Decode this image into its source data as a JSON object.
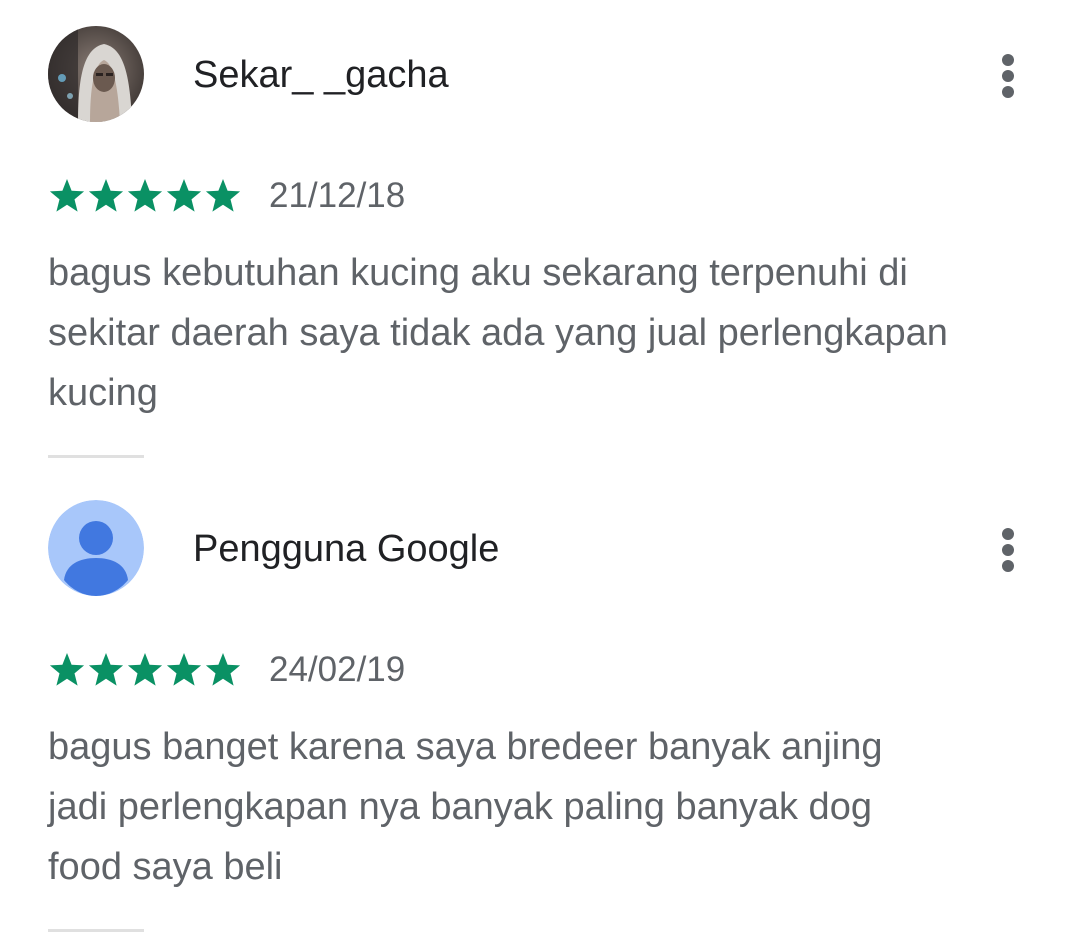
{
  "colors": {
    "star": "#0a9164",
    "author_text": "#202124",
    "secondary_text": "#5f6368",
    "divider": "#e0e0e0",
    "default_avatar_bg": "#a8c7fa",
    "default_avatar_fg": "#4178e0"
  },
  "reviews": [
    {
      "author": "Sekar_ _gacha",
      "avatar_icon": "user-photo-avatar",
      "menu_icon": "more-vert-icon",
      "rating": 5,
      "max_rating": 5,
      "date": "21/12/18",
      "lines": [
        "bagus kebutuhan kucing aku sekarang terpenuhi di",
        "sekitar daerah saya tidak ada yang jual perlengkapan",
        "kucing"
      ]
    },
    {
      "author": "Pengguna Google",
      "avatar_icon": "default-person-avatar",
      "menu_icon": "more-vert-icon",
      "rating": 5,
      "max_rating": 5,
      "date": "24/02/19",
      "lines": [
        "bagus banget karena saya bredeer banyak anjing",
        "jadi perlengkapan nya banyak paling banyak dog",
        "food saya beli"
      ]
    }
  ]
}
